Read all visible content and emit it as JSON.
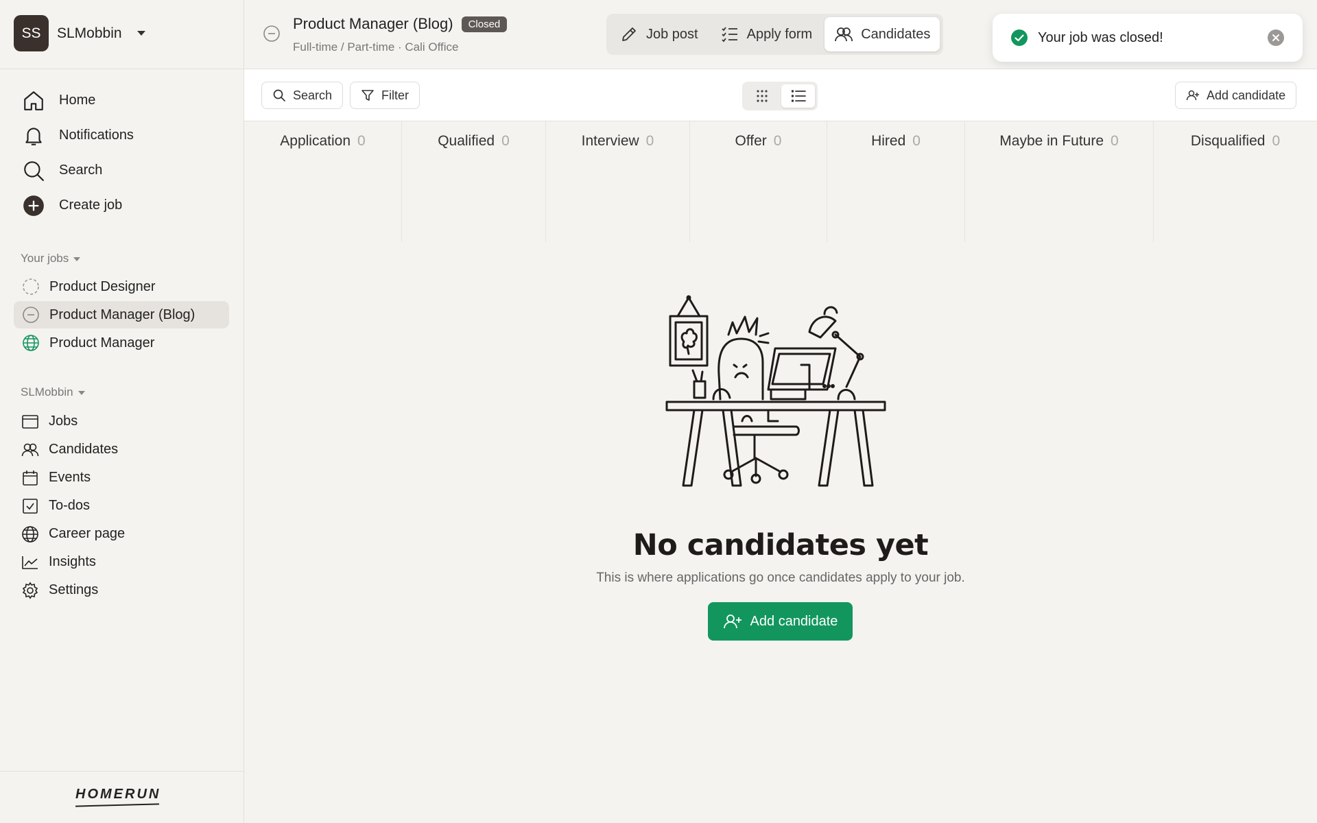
{
  "workspace": {
    "initials": "SS",
    "name": "SLMobbin"
  },
  "main_nav": [
    {
      "label": "Home",
      "icon": "home-icon"
    },
    {
      "label": "Notifications",
      "icon": "bell-icon"
    },
    {
      "label": "Search",
      "icon": "search-icon"
    },
    {
      "label": "Create job",
      "icon": "plus-circle-icon"
    }
  ],
  "your_jobs": {
    "title": "Your jobs",
    "items": [
      {
        "label": "Product Designer",
        "status": "draft",
        "icon": "dashed-circle-icon"
      },
      {
        "label": "Product Manager (Blog)",
        "status": "closed",
        "icon": "minus-circle-icon",
        "active": true
      },
      {
        "label": "Product Manager",
        "status": "published",
        "icon": "globe-icon",
        "color": "#12965e"
      }
    ]
  },
  "org_nav": {
    "title": "SLMobbin",
    "items": [
      {
        "label": "Jobs",
        "icon": "browser-icon"
      },
      {
        "label": "Candidates",
        "icon": "users-icon"
      },
      {
        "label": "Events",
        "icon": "calendar-icon"
      },
      {
        "label": "To-dos",
        "icon": "checkbox-icon"
      },
      {
        "label": "Career page",
        "icon": "globe-icon"
      },
      {
        "label": "Insights",
        "icon": "chart-icon"
      },
      {
        "label": "Settings",
        "icon": "gear-icon"
      }
    ]
  },
  "brand": {
    "logo_text": "HOMERUN"
  },
  "header": {
    "title": "Product Manager (Blog)",
    "badge": "Closed",
    "subtitle": "Full-time / Part-time · Cali Office",
    "tabs": [
      {
        "label": "Job post",
        "icon": "pencil-icon"
      },
      {
        "label": "Apply form",
        "icon": "list-check-icon"
      },
      {
        "label": "Candidates",
        "icon": "users-icon",
        "active": true
      }
    ]
  },
  "toast": {
    "message": "Your job was closed!",
    "icon": "check-circle-icon",
    "color": "#12965e"
  },
  "toolbar": {
    "search_label": "Search",
    "filter_label": "Filter",
    "add_candidate_label": "Add candidate",
    "view": "list"
  },
  "pipeline": [
    {
      "stage": "Application",
      "count": "0"
    },
    {
      "stage": "Qualified",
      "count": "0"
    },
    {
      "stage": "Interview",
      "count": "0"
    },
    {
      "stage": "Offer",
      "count": "0"
    },
    {
      "stage": "Hired",
      "count": "0"
    },
    {
      "stage": "Maybe in Future",
      "count": "0"
    },
    {
      "stage": "Disqualified",
      "count": "0"
    }
  ],
  "empty_state": {
    "title": "No candidates yet",
    "subtitle": "This is where applications go once candidates apply to your job.",
    "cta_label": "Add candidate",
    "accent": "#12965e"
  }
}
